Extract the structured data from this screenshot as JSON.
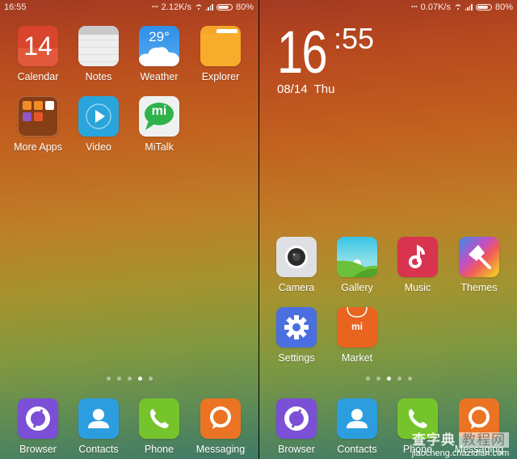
{
  "screens": [
    {
      "status": {
        "time": "16:55",
        "speed": "2.12K/s",
        "battery": "80%",
        "battery_level": 0.8
      },
      "apps": [
        {
          "label": "Calendar",
          "icon": "calendar-icon",
          "badge_text": "14"
        },
        {
          "label": "Notes",
          "icon": "notes-icon"
        },
        {
          "label": "Weather",
          "icon": "weather-icon",
          "badge_text": "29°"
        },
        {
          "label": "Explorer",
          "icon": "folder-icon"
        },
        {
          "label": "More Apps",
          "icon": "app-folder-icon"
        },
        {
          "label": "Video",
          "icon": "play-icon"
        },
        {
          "label": "MiTalk",
          "icon": "mitalk-icon",
          "badge_text": "mi"
        }
      ],
      "pager": {
        "count": 5,
        "active": 3
      },
      "dock": [
        {
          "label": "Browser",
          "icon": "browser-icon"
        },
        {
          "label": "Contacts",
          "icon": "contacts-icon"
        },
        {
          "label": "Phone",
          "icon": "phone-icon"
        },
        {
          "label": "Messaging",
          "icon": "messaging-icon"
        }
      ]
    },
    {
      "status": {
        "speed": "0.07K/s",
        "battery": "80%",
        "battery_level": 0.8
      },
      "clock": {
        "hours": "16",
        "minutes": ":55",
        "date": "08/14  Thu"
      },
      "apps": [
        {
          "label": "Camera",
          "icon": "camera-icon"
        },
        {
          "label": "Gallery",
          "icon": "gallery-icon"
        },
        {
          "label": "Music",
          "icon": "music-icon"
        },
        {
          "label": "Themes",
          "icon": "themes-icon"
        },
        {
          "label": "Settings",
          "icon": "gear-icon"
        },
        {
          "label": "Market",
          "icon": "market-icon",
          "badge_text": "mi"
        }
      ],
      "pager": {
        "count": 5,
        "active": 2
      },
      "dock": [
        {
          "label": "Browser",
          "icon": "browser-icon"
        },
        {
          "label": "Contacts",
          "icon": "contacts-icon"
        },
        {
          "label": "Phone",
          "icon": "phone-icon"
        },
        {
          "label": "Messaging",
          "icon": "messaging-icon"
        }
      ]
    }
  ],
  "watermark": {
    "title": "查字典",
    "box": "教程网",
    "url": "jiaocheng.chazidian.com"
  }
}
